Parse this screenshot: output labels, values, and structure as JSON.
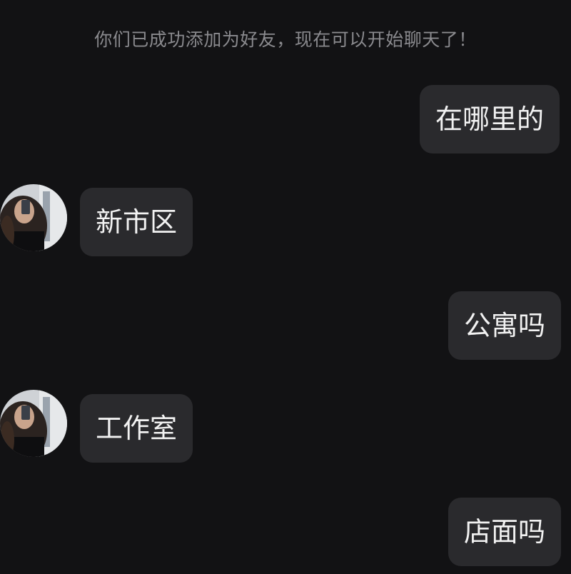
{
  "chat": {
    "system_notice": "你们已成功添加为好友，现在可以开始聊天了！",
    "messages": [
      {
        "sender": "self",
        "text": "在哪里的"
      },
      {
        "sender": "contact",
        "text": "新市区"
      },
      {
        "sender": "self",
        "text": "公寓吗"
      },
      {
        "sender": "contact",
        "text": "工作室"
      },
      {
        "sender": "self",
        "text": "店面吗"
      }
    ]
  },
  "colors": {
    "background": "#121214",
    "bubble": "#2a2a2d",
    "text": "#f2f2f2",
    "notice_text": "#8a8a8e"
  }
}
